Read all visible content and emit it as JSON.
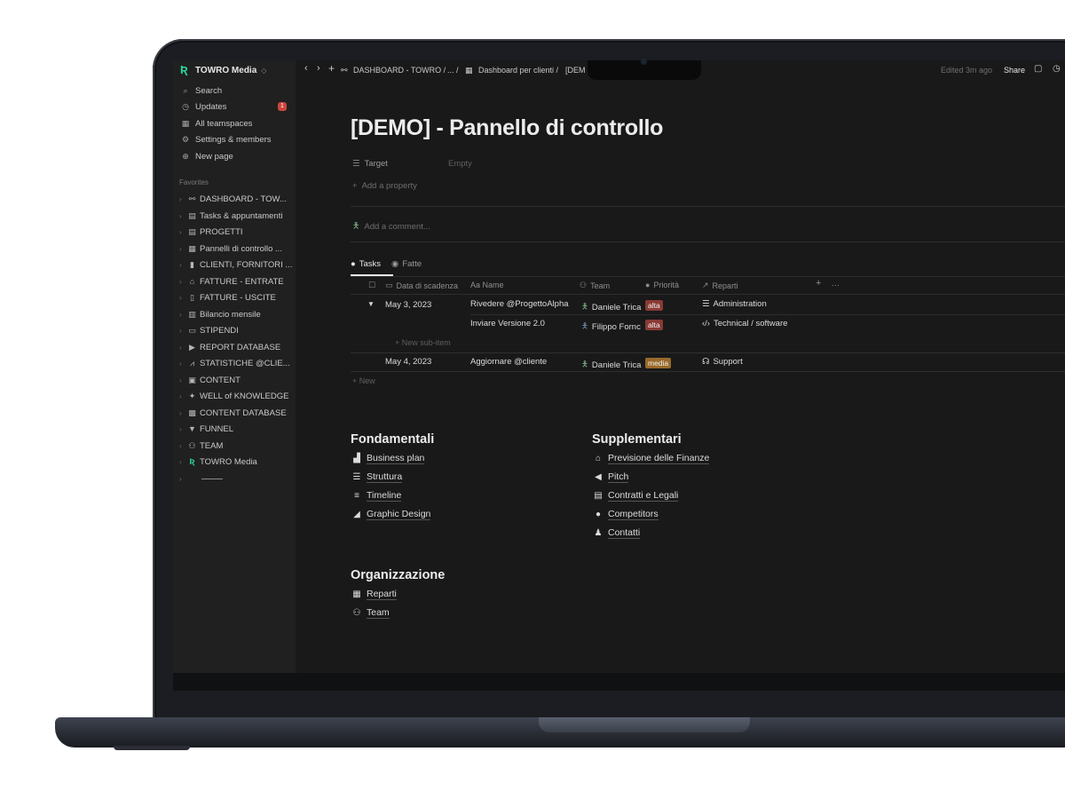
{
  "workspace": {
    "name": "TOWRO Media"
  },
  "sidebar": {
    "nav": [
      {
        "label": "Search",
        "icon": "search-icon"
      },
      {
        "label": "Updates",
        "icon": "clock-icon",
        "badge": "1"
      },
      {
        "label": "All teamspaces",
        "icon": "teamspaces-icon"
      },
      {
        "label": "Settings & members",
        "icon": "gear-icon"
      },
      {
        "label": "New page",
        "icon": "plus-circle-icon"
      }
    ],
    "favorites_label": "Favorites",
    "favorites": [
      {
        "label": "DASHBOARD - TOW...",
        "icon": "nodes-icon"
      },
      {
        "label": "Tasks & appuntamenti",
        "icon": "table-icon"
      },
      {
        "label": "PROGETTI",
        "icon": "table-icon"
      },
      {
        "label": "Pannelli di controllo ...",
        "icon": "grid-icon"
      },
      {
        "label": "CLIENTI, FORNITORI ...",
        "icon": "contact-icon"
      },
      {
        "label": "FATTURE - ENTRATE",
        "icon": "bank-icon"
      },
      {
        "label": "FATTURE - USCITE",
        "icon": "receipt-icon"
      },
      {
        "label": "Bilancio mensile",
        "icon": "calendar-icon"
      },
      {
        "label": "STIPENDI",
        "icon": "card-icon"
      },
      {
        "label": "REPORT DATABASE",
        "icon": "play-icon"
      },
      {
        "label": "STATISTICHE @CLIE...",
        "icon": "chart-icon"
      },
      {
        "label": "CONTENT",
        "icon": "layout-icon"
      },
      {
        "label": "WELL of KNOWLEDGE",
        "icon": "wand-icon"
      },
      {
        "label": "CONTENT DATABASE",
        "icon": "media-icon"
      },
      {
        "label": "FUNNEL",
        "icon": "funnel-icon"
      },
      {
        "label": "TEAM",
        "icon": "people-icon"
      },
      {
        "label": "TOWRO Media",
        "icon": "logo-icon"
      },
      {
        "label": "",
        "icon": "divider"
      }
    ]
  },
  "topbar": {
    "breadcrumb_1": "DASHBOARD - TOWRO /",
    "breadcrumb_ellipsis": "... /",
    "breadcrumb_2": "Dashboard per clienti /",
    "breadcrumb_3": "[DEM",
    "edited": "Edited 3m ago",
    "share": "Share"
  },
  "page": {
    "title": "[DEMO] - Pannello di controllo",
    "property_name": "Target",
    "property_value": "Empty",
    "add_property": "Add a property",
    "add_comment": "Add a comment..."
  },
  "tabs": [
    {
      "label": "Tasks",
      "active": true
    },
    {
      "label": "Fatte",
      "active": false
    }
  ],
  "table": {
    "headers": [
      "Data di scadenza",
      "Aa Name",
      "Team",
      "Priorità",
      "Reparti"
    ],
    "rows": [
      {
        "date": "May 3, 2023",
        "name": "Rivedere @ProgettoAlpha",
        "team": "Daniele Trica",
        "priority": "alta",
        "priority_color": "#8a3a34",
        "reparto": "Administration"
      },
      {
        "date": "",
        "name": "Inviare Versione 2.0",
        "team": "Filippo Fornc",
        "priority": "alta",
        "priority_color": "#8a3a34",
        "reparto": "Technical / software"
      },
      {
        "date": "May 4, 2023",
        "name": "Aggiornare @cliente",
        "team": "Daniele Trica",
        "priority": "media",
        "priority_color": "#9a6a2a",
        "reparto": "Support"
      }
    ],
    "new_sub_item": "+ New sub-item",
    "new": "+ New"
  },
  "sections": {
    "fondamentali": {
      "title": "Fondamentali",
      "links": [
        "Business plan",
        "Struttura",
        "Timeline",
        "Graphic Design"
      ]
    },
    "supplementari": {
      "title": "Supplementari",
      "links": [
        "Previsione delle Finanze",
        "Pitch",
        "Contratti e Legali",
        "Competitors",
        "Contatti"
      ]
    },
    "organizzazione": {
      "title": "Organizzazione",
      "links": [
        "Reparti",
        "Team"
      ]
    }
  }
}
